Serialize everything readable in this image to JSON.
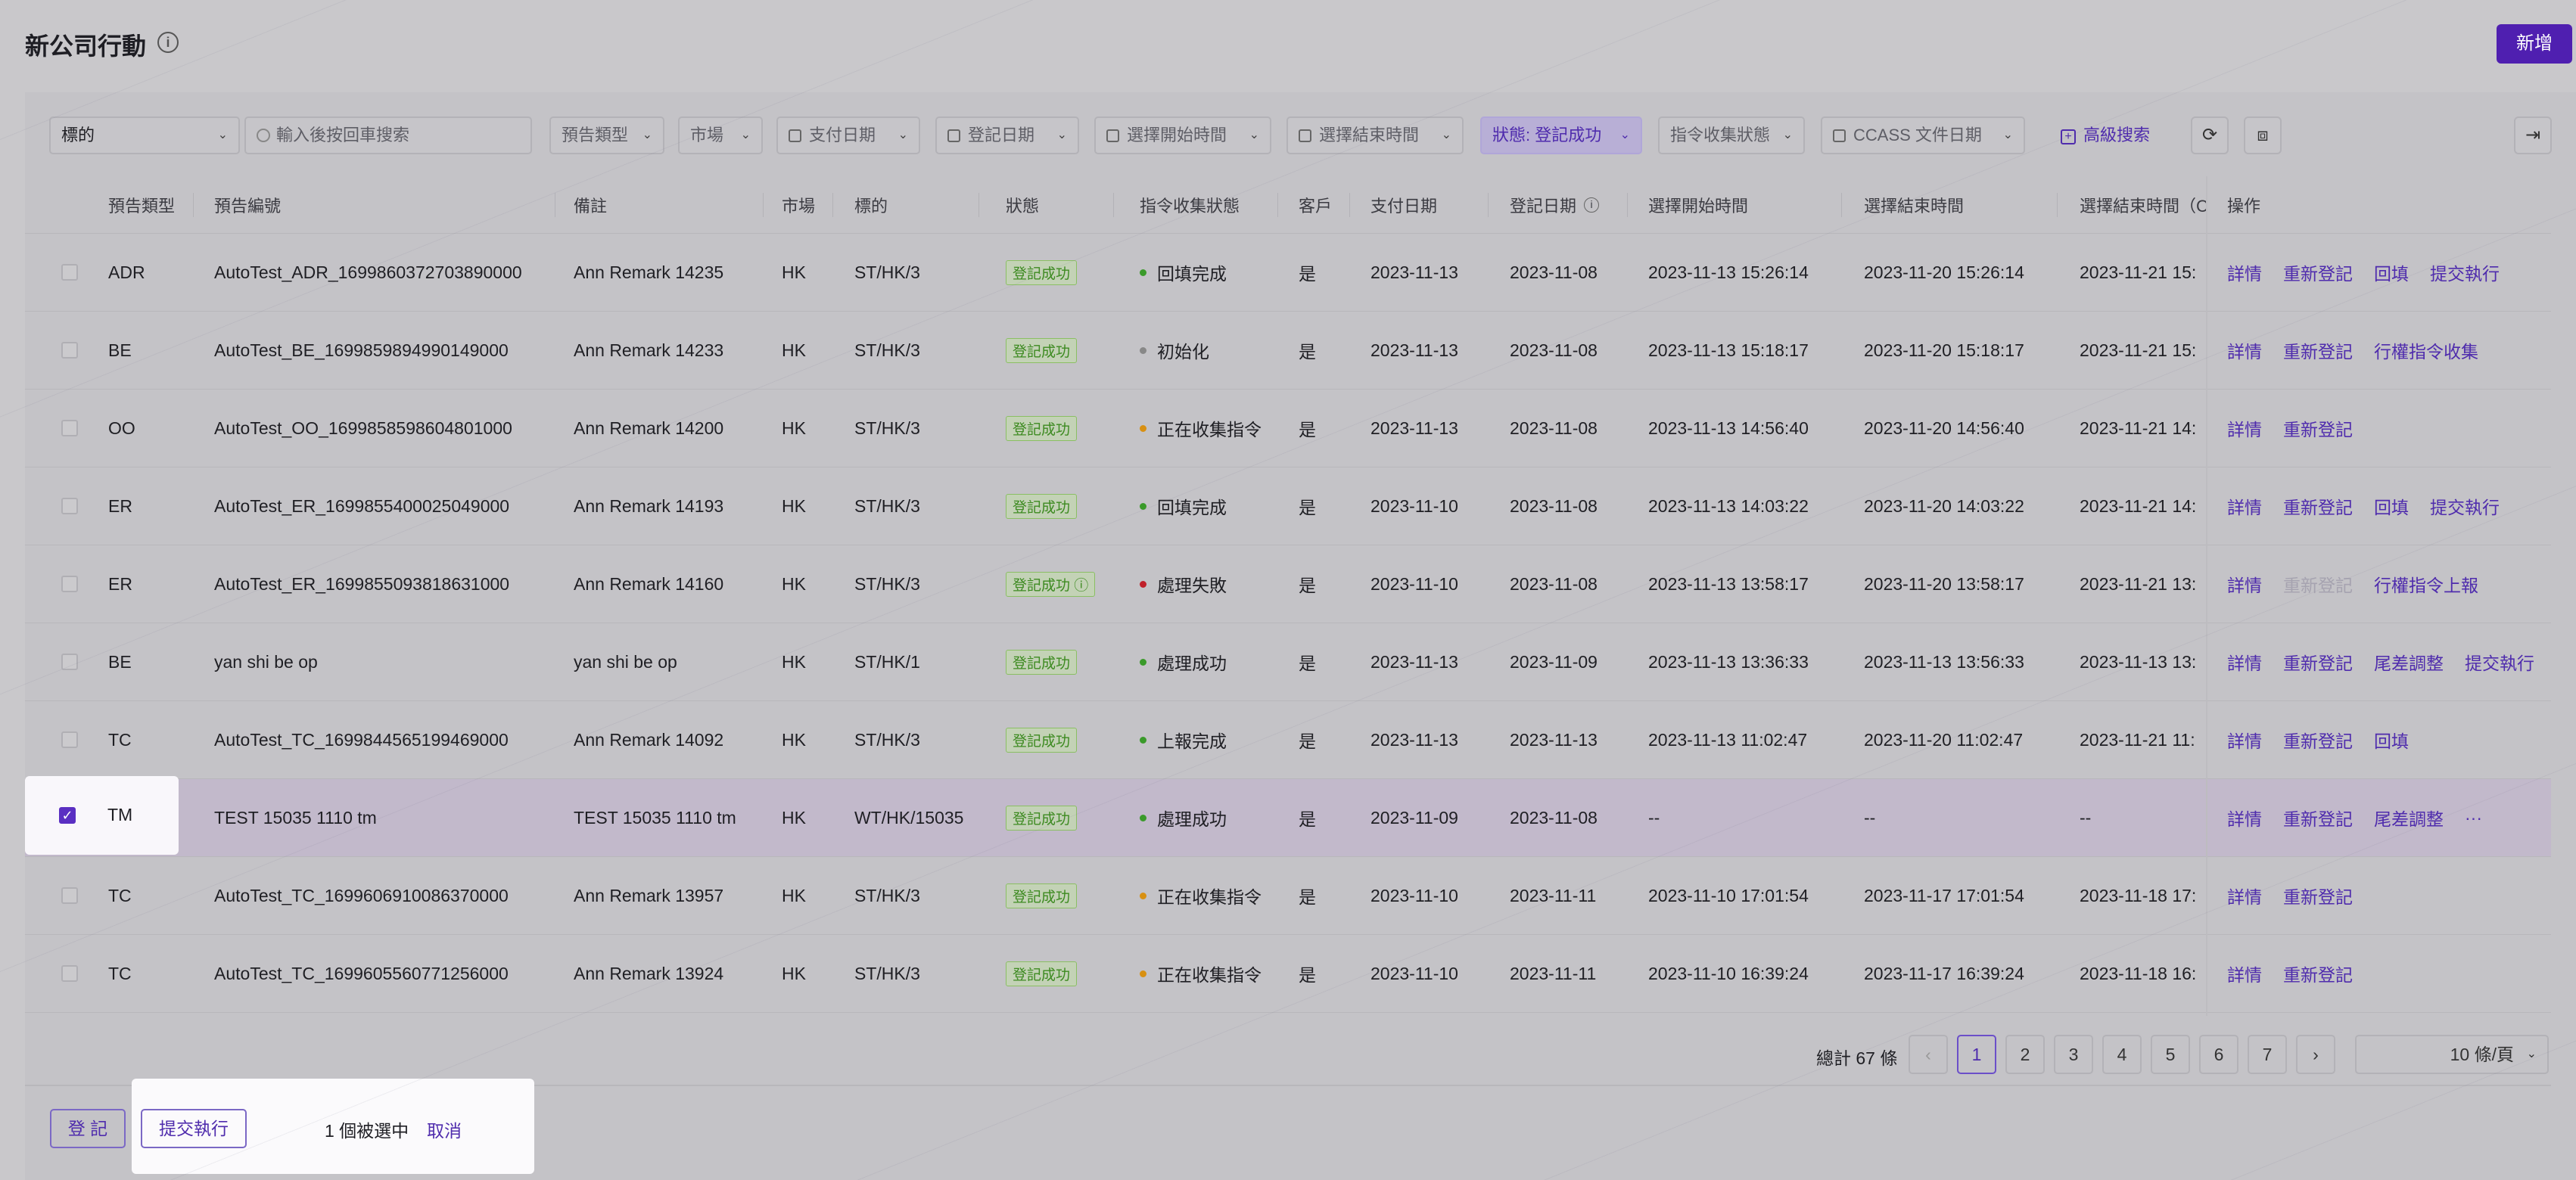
{
  "header": {
    "title": "新公司行動",
    "add_label": "新增"
  },
  "filters": {
    "target": "標的",
    "search_placeholder": "輸入後按回車搜索",
    "type": "預告類型",
    "market": "市場",
    "pay_date": "支付日期",
    "reg_date": "登記日期",
    "sel_start": "選擇開始時間",
    "sel_end": "選擇結束時間",
    "status": "狀態: 登記成功",
    "collect": "指令收集狀態",
    "ccass": "CCASS 文件日期",
    "advanced": "高級搜索"
  },
  "columns": {
    "type": "預告類型",
    "code": "預告編號",
    "remark": "備註",
    "market": "市場",
    "target": "標的",
    "status": "狀態",
    "collect": "指令收集狀態",
    "client": "客戶",
    "pay": "支付日期",
    "reg": "登記日期",
    "start": "選擇開始時間",
    "end": "選擇結束時間",
    "end2": "選擇結束時間（C",
    "ops": "操作"
  },
  "rows": [
    {
      "type": "ADR",
      "code": "AutoTest_ADR_1699860372703890000",
      "remark": "Ann Remark 14235",
      "market": "HK",
      "target": "ST/HK/3",
      "status": "登記成功",
      "collect": "回填完成",
      "dot": "#3a9a2a",
      "client": "是",
      "pay": "2023-11-13",
      "reg": "2023-11-08",
      "start": "2023-11-13 15:26:14",
      "end": "2023-11-20 15:26:14",
      "end2": "2023-11-21 15:",
      "actions": [
        "詳情",
        "重新登記",
        "回填",
        "提交執行"
      ]
    },
    {
      "type": "BE",
      "code": "AutoTest_BE_1699859894990149000",
      "remark": "Ann Remark 14233",
      "market": "HK",
      "target": "ST/HK/3",
      "status": "登記成功",
      "collect": "初始化",
      "dot": "#888888",
      "client": "是",
      "pay": "2023-11-13",
      "reg": "2023-11-08",
      "start": "2023-11-13 15:18:17",
      "end": "2023-11-20 15:18:17",
      "end2": "2023-11-21 15:",
      "actions": [
        "詳情",
        "重新登記",
        "行權指令收集"
      ]
    },
    {
      "type": "OO",
      "code": "AutoTest_OO_1699858598604801000",
      "remark": "Ann Remark 14200",
      "market": "HK",
      "target": "ST/HK/3",
      "status": "登記成功",
      "collect": "正在收集指令",
      "dot": "#d89012",
      "client": "是",
      "pay": "2023-11-13",
      "reg": "2023-11-08",
      "start": "2023-11-13 14:56:40",
      "end": "2023-11-20 14:56:40",
      "end2": "2023-11-21 14:",
      "actions": [
        "詳情",
        "重新登記"
      ]
    },
    {
      "type": "ER",
      "code": "AutoTest_ER_1699855400025049000",
      "remark": "Ann Remark 14193",
      "market": "HK",
      "target": "ST/HK/3",
      "status": "登記成功",
      "collect": "回填完成",
      "dot": "#3a9a2a",
      "client": "是",
      "pay": "2023-11-10",
      "reg": "2023-11-08",
      "start": "2023-11-13 14:03:22",
      "end": "2023-11-20 14:03:22",
      "end2": "2023-11-21 14:",
      "actions": [
        "詳情",
        "重新登記",
        "回填",
        "提交執行"
      ]
    },
    {
      "type": "ER",
      "code": "AutoTest_ER_1699855093818631000",
      "remark": "Ann Remark 14160",
      "market": "HK",
      "target": "ST/HK/3",
      "status": "登記成功 ⓘ",
      "collect": "處理失敗",
      "dot": "#c0202a",
      "client": "是",
      "pay": "2023-11-10",
      "reg": "2023-11-08",
      "start": "2023-11-13 13:58:17",
      "end": "2023-11-20 13:58:17",
      "end2": "2023-11-21 13:",
      "actions": [
        "詳情",
        "重新登記",
        "行權指令上報"
      ]
    },
    {
      "type": "BE",
      "code": "yan shi be op",
      "remark": "yan shi be op",
      "market": "HK",
      "target": "ST/HK/1",
      "status": "登記成功",
      "collect": "處理成功",
      "dot": "#3a9a2a",
      "client": "是",
      "pay": "2023-11-13",
      "reg": "2023-11-09",
      "start": "2023-11-13 13:36:33",
      "end": "2023-11-13 13:56:33",
      "end2": "2023-11-13 13:",
      "actions": [
        "詳情",
        "重新登記",
        "尾差調整",
        "提交執行"
      ]
    },
    {
      "type": "TC",
      "code": "AutoTest_TC_1699844565199469000",
      "remark": "Ann Remark 14092",
      "market": "HK",
      "target": "ST/HK/3",
      "status": "登記成功",
      "collect": "上報完成",
      "dot": "#3a9a2a",
      "client": "是",
      "pay": "2023-11-13",
      "reg": "2023-11-13",
      "start": "2023-11-13 11:02:47",
      "end": "2023-11-20 11:02:47",
      "end2": "2023-11-21 11:",
      "actions": [
        "詳情",
        "重新登記",
        "回填"
      ]
    },
    {
      "type": "TM",
      "code": "TEST 15035 1110 tm",
      "remark": "TEST 15035 1110 tm",
      "market": "HK",
      "target": "WT/HK/15035",
      "status": "登記成功",
      "collect": "處理成功",
      "dot": "#3a9a2a",
      "client": "是",
      "pay": "2023-11-09",
      "reg": "2023-11-08",
      "start": "--",
      "end": "--",
      "end2": "--",
      "actions": [
        "詳情",
        "重新登記",
        "尾差調整",
        "···"
      ]
    },
    {
      "type": "TC",
      "code": "AutoTest_TC_1699606910086370000",
      "remark": "Ann Remark 13957",
      "market": "HK",
      "target": "ST/HK/3",
      "status": "登記成功",
      "collect": "正在收集指令",
      "dot": "#d89012",
      "client": "是",
      "pay": "2023-11-10",
      "reg": "2023-11-11",
      "start": "2023-11-10 17:01:54",
      "end": "2023-11-17 17:01:54",
      "end2": "2023-11-18 17:",
      "actions": [
        "詳情",
        "重新登記"
      ]
    },
    {
      "type": "TC",
      "code": "AutoTest_TC_1699605560771256000",
      "remark": "Ann Remark 13924",
      "market": "HK",
      "target": "ST/HK/3",
      "status": "登記成功",
      "collect": "正在收集指令",
      "dot": "#d89012",
      "client": "是",
      "pay": "2023-11-10",
      "reg": "2023-11-11",
      "start": "2023-11-10 16:39:24",
      "end": "2023-11-17 16:39:24",
      "end2": "2023-11-18 16:",
      "actions": [
        "詳情",
        "重新登記"
      ]
    }
  ],
  "selected_row": {
    "type": "TM"
  },
  "pagination": {
    "total": "總計 67 條",
    "pages": [
      "1",
      "2",
      "3",
      "4",
      "5",
      "6",
      "7"
    ],
    "current": "1",
    "page_size": "10 條/頁"
  },
  "footer": {
    "register": "登 記",
    "submit": "提交執行",
    "selected_text": "1 個被選中",
    "cancel": "取消"
  }
}
